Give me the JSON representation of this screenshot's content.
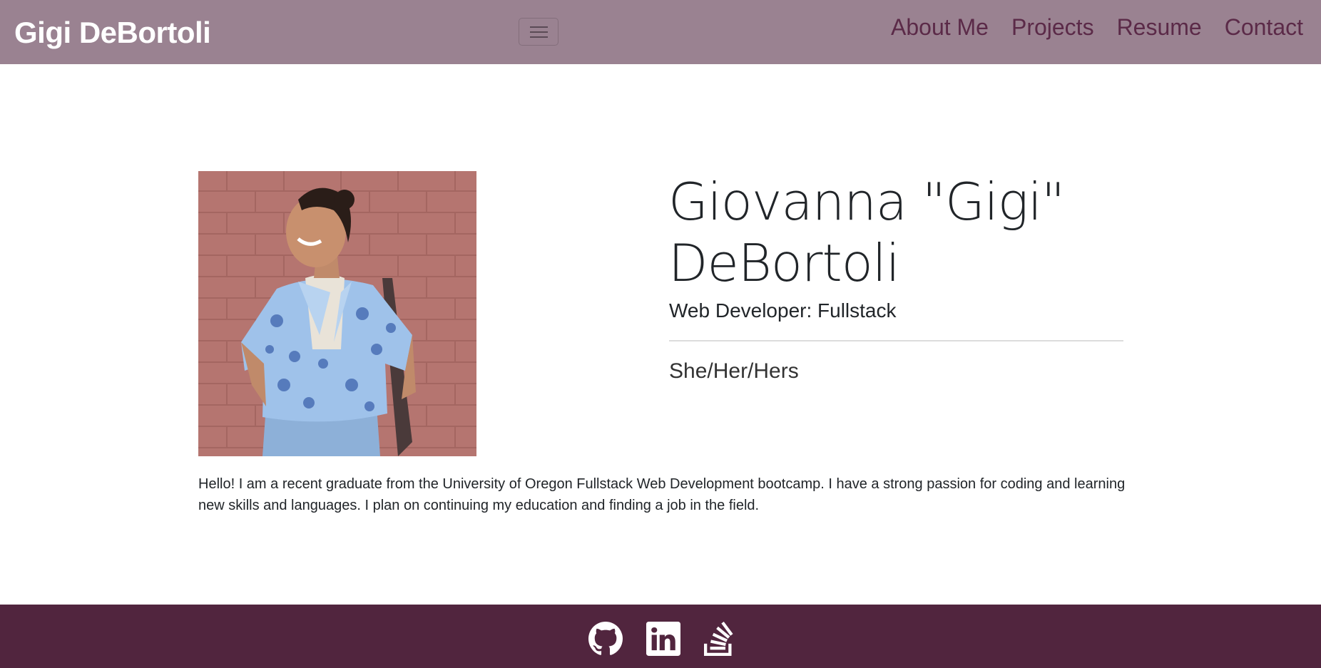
{
  "navbar": {
    "brand": "Gigi DeBortoli",
    "links": [
      {
        "label": "About Me"
      },
      {
        "label": "Projects"
      },
      {
        "label": "Resume"
      },
      {
        "label": "Contact"
      }
    ],
    "background": "#9a8291",
    "link_color": "#5b2a48"
  },
  "profile": {
    "name": "Giovanna \"Gigi\" DeBortoli",
    "role": "Web Developer: Fullstack",
    "pronouns": "She/Her/Hers",
    "bio": "Hello! I am a recent graduate from the University of Oregon Fullstack Web Development bootcamp. I have a strong passion for coding and learning new skills and languages. I plan on continuing my education and finding a job in the field."
  },
  "footer": {
    "background": "#51253e",
    "icons": [
      "github-icon",
      "linkedin-icon",
      "stack-overflow-icon"
    ]
  }
}
